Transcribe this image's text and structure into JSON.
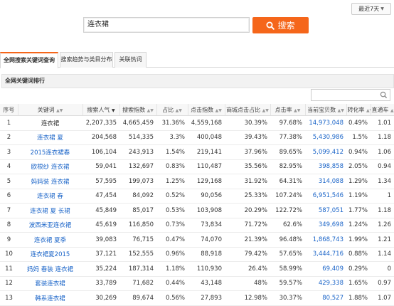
{
  "range": {
    "label": "最近7天"
  },
  "search": {
    "value": "连衣裙",
    "button_label": "搜索"
  },
  "tabs": [
    {
      "label": "全网搜索关键词查询",
      "active": true
    },
    {
      "label": "搜索趋势与类目分布",
      "active": false
    },
    {
      "label": "关联热词",
      "active": false
    }
  ],
  "section": {
    "title": "全网关键词排行"
  },
  "colors": {
    "accent": "#f5661a",
    "link": "#1a64c8"
  },
  "table": {
    "headers": [
      "序号",
      "关键词",
      "搜索人气",
      "搜索指数",
      "占比",
      "点击指数",
      "商城点击占比",
      "点击率",
      "当前宝贝数",
      "转化率",
      "直通车"
    ],
    "rows": [
      {
        "idx": "1",
        "keyword": "连衣裙",
        "link": false,
        "popularity": "2,207,335",
        "index": "4,665,459",
        "share": "31.36%",
        "click_index": "4,559,168",
        "mall_share": "30.39%",
        "ctr": "97.68%",
        "items": "14,973,048",
        "cvr": "0.49%",
        "ztc": "1.01"
      },
      {
        "idx": "2",
        "keyword": "连衣裙 夏",
        "link": true,
        "popularity": "204,568",
        "index": "514,335",
        "share": "3.3%",
        "click_index": "400,048",
        "mall_share": "39.43%",
        "ctr": "77.38%",
        "items": "5,430,986",
        "cvr": "1.5%",
        "ztc": "1.18"
      },
      {
        "idx": "3",
        "keyword": "2015连衣裙春",
        "link": true,
        "popularity": "106,104",
        "index": "243,913",
        "share": "1.54%",
        "click_index": "219,141",
        "mall_share": "37.96%",
        "ctr": "89.65%",
        "items": "5,099,412",
        "cvr": "0.94%",
        "ztc": "1.06"
      },
      {
        "idx": "4",
        "keyword": "欧根纱 连衣裙",
        "link": true,
        "popularity": "59,041",
        "index": "132,697",
        "share": "0.83%",
        "click_index": "110,487",
        "mall_share": "35.56%",
        "ctr": "82.95%",
        "items": "398,858",
        "cvr": "2.05%",
        "ztc": "0.94"
      },
      {
        "idx": "5",
        "keyword": "妈妈装 连衣裙",
        "link": true,
        "popularity": "57,595",
        "index": "199,073",
        "share": "1.25%",
        "click_index": "129,168",
        "mall_share": "31.92%",
        "ctr": "64.31%",
        "items": "314,088",
        "cvr": "1.29%",
        "ztc": "1.34"
      },
      {
        "idx": "6",
        "keyword": "连衣裙 春",
        "link": true,
        "popularity": "47,454",
        "index": "84,092",
        "share": "0.52%",
        "click_index": "90,056",
        "mall_share": "25.33%",
        "ctr": "107.24%",
        "items": "6,951,546",
        "cvr": "1.19%",
        "ztc": "1"
      },
      {
        "idx": "7",
        "keyword": "连衣裙 夏 长裙",
        "link": true,
        "popularity": "45,849",
        "index": "85,017",
        "share": "0.53%",
        "click_index": "103,908",
        "mall_share": "20.29%",
        "ctr": "122.72%",
        "items": "587,051",
        "cvr": "1.77%",
        "ztc": "1.18"
      },
      {
        "idx": "8",
        "keyword": "波西米亚连衣裙",
        "link": true,
        "popularity": "45,619",
        "index": "116,850",
        "share": "0.73%",
        "click_index": "73,834",
        "mall_share": "71.72%",
        "ctr": "62.6%",
        "items": "349,698",
        "cvr": "1.24%",
        "ztc": "1.26"
      },
      {
        "idx": "9",
        "keyword": "连衣裙 夏季",
        "link": true,
        "popularity": "39,083",
        "index": "76,715",
        "share": "0.47%",
        "click_index": "74,070",
        "mall_share": "21.39%",
        "ctr": "96.48%",
        "items": "1,868,743",
        "cvr": "1.99%",
        "ztc": "1.21"
      },
      {
        "idx": "10",
        "keyword": "连衣裙夏2015",
        "link": true,
        "popularity": "37,121",
        "index": "152,555",
        "share": "0.96%",
        "click_index": "88,918",
        "mall_share": "79.42%",
        "ctr": "57.65%",
        "items": "3,444,716",
        "cvr": "0.88%",
        "ztc": "1.14"
      },
      {
        "idx": "11",
        "keyword": "妈妈 春装 连衣裙",
        "link": true,
        "popularity": "35,224",
        "index": "187,314",
        "share": "1.18%",
        "click_index": "110,930",
        "mall_share": "26.4%",
        "ctr": "58.99%",
        "items": "69,409",
        "cvr": "0.29%",
        "ztc": "0"
      },
      {
        "idx": "12",
        "keyword": "套装连衣裙",
        "link": true,
        "popularity": "33,789",
        "index": "71,682",
        "share": "0.44%",
        "click_index": "43,148",
        "mall_share": "48%",
        "ctr": "59.57%",
        "items": "429,338",
        "cvr": "1.65%",
        "ztc": "0.97"
      },
      {
        "idx": "13",
        "keyword": "韩系连衣裙",
        "link": true,
        "popularity": "30,269",
        "index": "89,674",
        "share": "0.56%",
        "click_index": "27,893",
        "mall_share": "12.98%",
        "ctr": "30.37%",
        "items": "80,527",
        "cvr": "1.88%",
        "ztc": "1.07"
      }
    ]
  }
}
